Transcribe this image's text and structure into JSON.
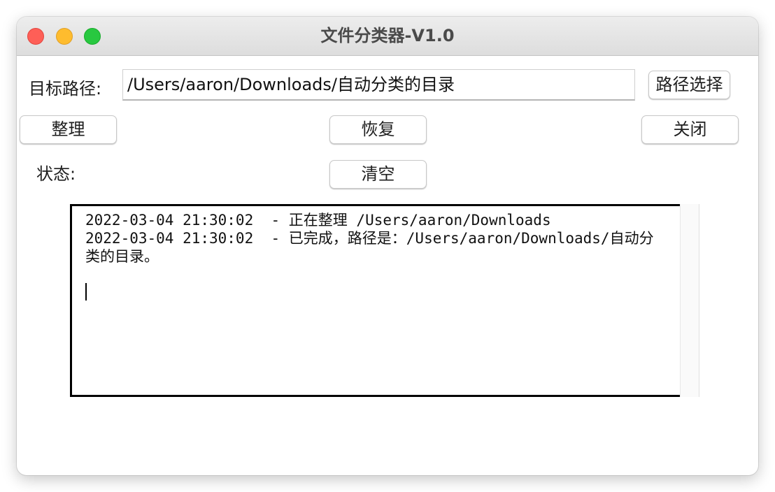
{
  "window": {
    "title": "文件分类器-V1.0"
  },
  "path_row": {
    "label": "目标路径:",
    "value": "/Users/aaron/Downloads/自动分类的目录",
    "select_button": "路径选择"
  },
  "actions": {
    "organize": "整理",
    "restore": "恢复",
    "close": "关闭",
    "clear": "清空"
  },
  "status": {
    "label": "状态:"
  },
  "log": {
    "lines": [
      "2022-03-04 21:30:02  - 正在整理 /Users/aaron/Downloads",
      "2022-03-04 21:30:02  - 已完成，路径是：/Users/aaron/Downloads/自动分类的目录。"
    ]
  },
  "colors": {
    "close_dot": "#fe5f57",
    "minimize_dot": "#febc2e",
    "maximize_dot": "#28c840"
  }
}
